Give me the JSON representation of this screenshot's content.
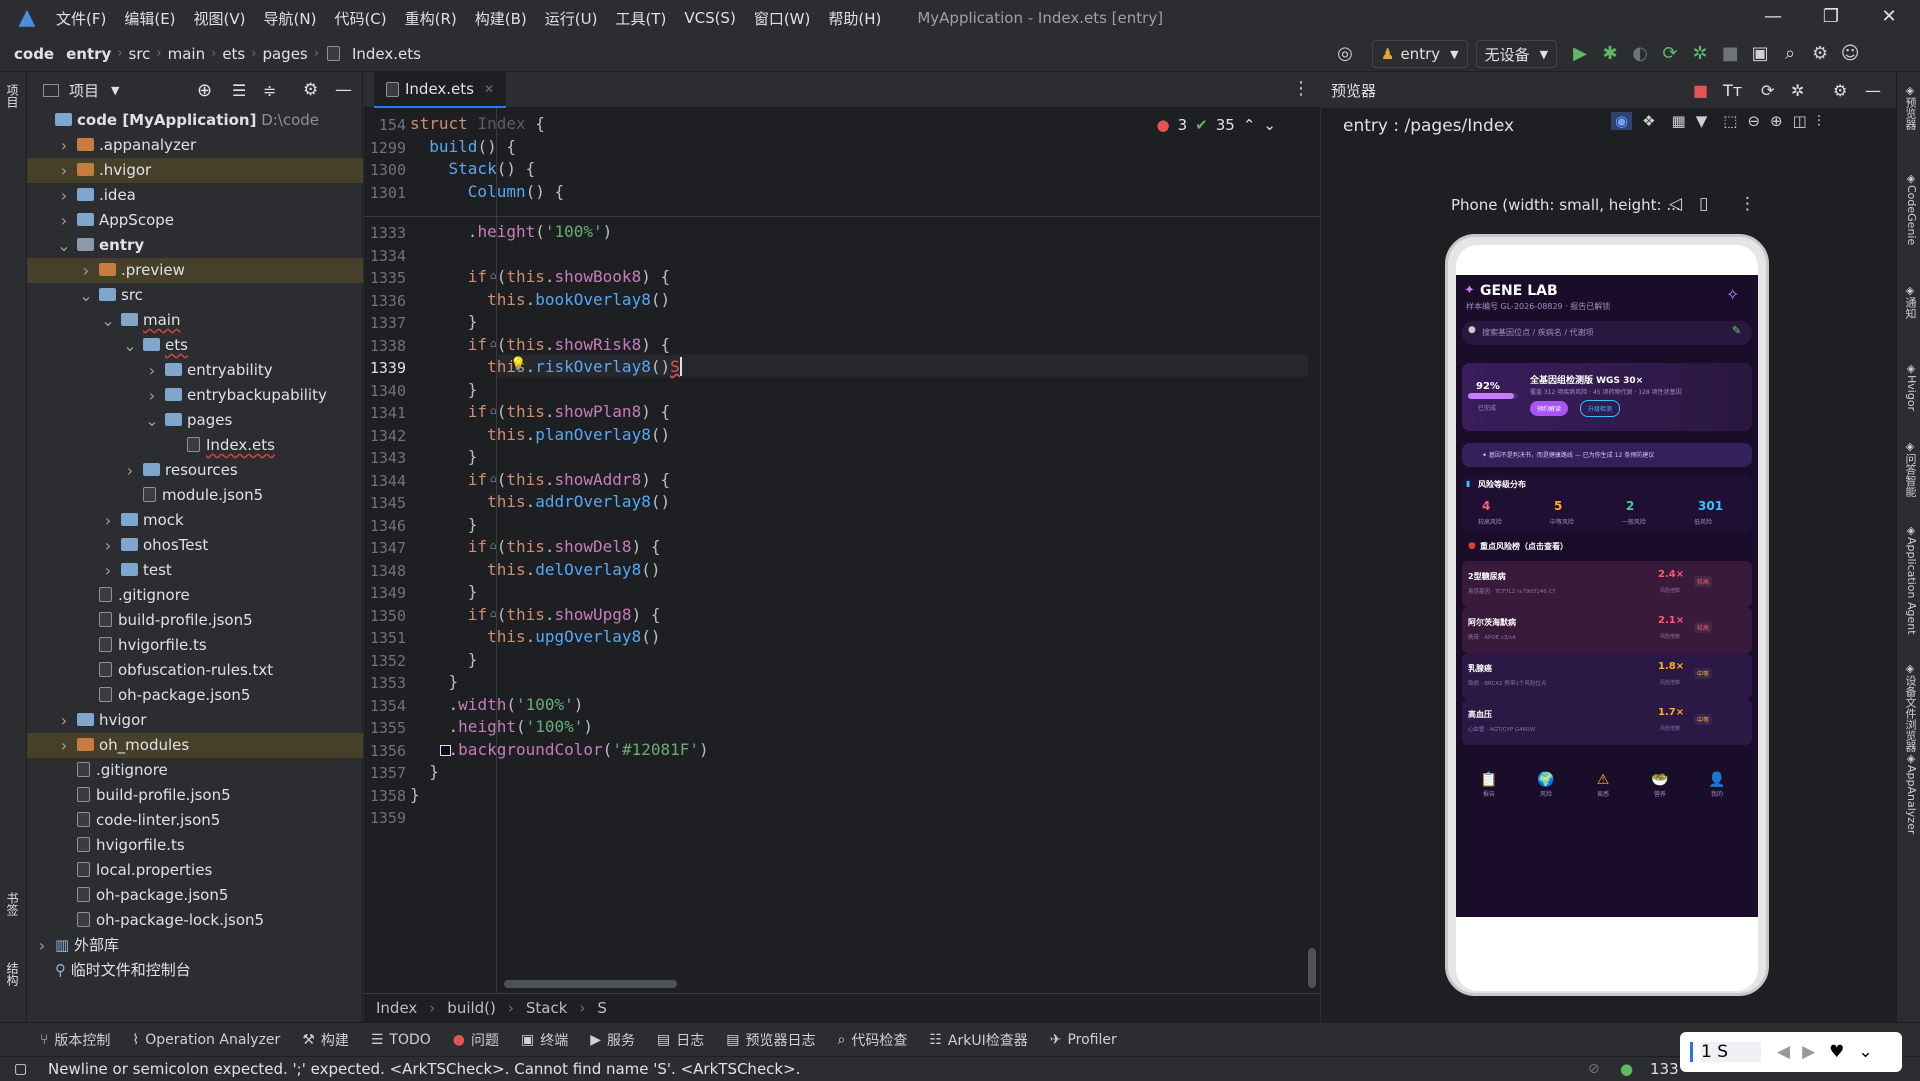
{
  "menubar": {
    "items": [
      "文件(F)",
      "编辑(E)",
      "视图(V)",
      "导航(N)",
      "代码(C)",
      "重构(R)",
      "构建(B)",
      "运行(U)",
      "工具(T)",
      "VCS(S)",
      "窗口(W)",
      "帮助(H)"
    ],
    "title": "MyApplication - Index.ets [entry]"
  },
  "navbar": {
    "crumbs": [
      "code",
      "entry",
      "src",
      "main",
      "ets",
      "pages",
      "Index.ets"
    ],
    "run_config": "entry",
    "device": "无设备"
  },
  "project": {
    "title": "项目",
    "root_name": "code [MyApplication]",
    "root_path": "D:\\code",
    "rows": [
      ".appanalyzer",
      ".hvigor",
      ".idea",
      "AppScope",
      "entry",
      ".preview",
      "src",
      "main",
      "ets",
      "entryability",
      "entrybackupability",
      "pages",
      "Index.ets",
      "resources",
      "module.json5",
      "mock",
      "ohosTest",
      "test",
      ".gitignore",
      "build-profile.json5",
      "hvigorfile.ts",
      "obfuscation-rules.txt",
      "oh-package.json5",
      "hvigor",
      "oh_modules",
      ".gitignore",
      "build-profile.json5",
      "code-linter.json5",
      "hvigorfile.ts",
      "local.properties",
      "oh-package.json5",
      "oh-package-lock.json5",
      "外部库",
      "临时文件和控制台"
    ]
  },
  "editor": {
    "tab": "Index.ets",
    "errors": "3",
    "warnings": "35",
    "sticky": [
      {
        "ln": "154",
        "code": "struct Index {"
      },
      {
        "ln": "1299",
        "code": "  build() {"
      },
      {
        "ln": "1300",
        "code": "    Stack() {"
      },
      {
        "ln": "1301",
        "code": "      Column() {"
      }
    ],
    "lines": [
      {
        "ln": "1333",
        "code": "      .height('100%')"
      },
      {
        "ln": "1334",
        "code": ""
      },
      {
        "ln": "1335",
        "code": "      if (this.showBook8) {"
      },
      {
        "ln": "1336",
        "code": "        this.bookOverlay8()"
      },
      {
        "ln": "1337",
        "code": "      }"
      },
      {
        "ln": "1338",
        "code": "      if (this.showRisk8) {"
      },
      {
        "ln": "1339",
        "code": "        this.riskOverlay8()S"
      },
      {
        "ln": "1340",
        "code": "      }"
      },
      {
        "ln": "1341",
        "code": "      if (this.showPlan8) {"
      },
      {
        "ln": "1342",
        "code": "        this.planOverlay8()"
      },
      {
        "ln": "1343",
        "code": "      }"
      },
      {
        "ln": "1344",
        "code": "      if (this.showAddr8) {"
      },
      {
        "ln": "1345",
        "code": "        this.addrOverlay8()"
      },
      {
        "ln": "1346",
        "code": "      }"
      },
      {
        "ln": "1347",
        "code": "      if (this.showDel8) {"
      },
      {
        "ln": "1348",
        "code": "        this.delOverlay8()"
      },
      {
        "ln": "1349",
        "code": "      }"
      },
      {
        "ln": "1350",
        "code": "      if (this.showUpg8) {"
      },
      {
        "ln": "1351",
        "code": "        this.upgOverlay8()"
      },
      {
        "ln": "1352",
        "code": "      }"
      },
      {
        "ln": "1353",
        "code": "    }"
      },
      {
        "ln": "1354",
        "code": "    .width('100%')"
      },
      {
        "ln": "1355",
        "code": "    .height('100%')"
      },
      {
        "ln": "1356",
        "code": "    .backgroundColor('#12081F')"
      },
      {
        "ln": "1357",
        "code": "  }"
      },
      {
        "ln": "1358",
        "code": "}"
      },
      {
        "ln": "1359",
        "code": ""
      }
    ],
    "breadcrumb": [
      "Index",
      "build()",
      "Stack",
      "S"
    ]
  },
  "preview": {
    "title": "预览器",
    "path": "entry : /pages/Index",
    "device": "Phone (width: small, height: ...",
    "app": {
      "brand": "GENE LAB",
      "sub": "样本编号 GL-2026-08829 · 报告已解锁",
      "search": "搜索基因位点 / 疾病名 / 代谢项",
      "pct": "92%",
      "pct_sub": "已完成",
      "card_title": "全基因组检测版 WGS 30×",
      "card_desc": "覆盖 312 项疾病风险 · 45 项药物代谢 · 128 项性状基因",
      "btn1": "预约解读",
      "btn2": "升级检测",
      "notice": "✦ 基因不是判决书，而是健康路线 — 已为你生成 12 条预防建议",
      "dist_title": "风险等级分布",
      "dist": [
        {
          "v": "4",
          "l": "较高风险",
          "c": "#ff5a6e"
        },
        {
          "v": "5",
          "l": "中等风险",
          "c": "#ffb020"
        },
        {
          "v": "2",
          "l": "一般风险",
          "c": "#3ed598"
        },
        {
          "v": "301",
          "l": "低风险",
          "c": "#33c3ff"
        }
      ],
      "risk_title": "重点风险榜（点击查看）",
      "risks": [
        {
          "name": "2型糖尿病",
          "sub": "易感基因 · TCF7L2 rs7903146 CT",
          "v": "2.4×",
          "vs": "风险倍数",
          "tag": "较高",
          "c": "#ff5a6e"
        },
        {
          "name": "阿尔茨海默病",
          "sub": "携带 · APOE ε3/ε4",
          "v": "2.1×",
          "vs": "风险倍数",
          "tag": "较高",
          "c": "#ff5a6e"
        },
        {
          "name": "乳腺癌",
          "sub": "致病 · BRCA2 携带1个风险位点",
          "v": "1.8×",
          "vs": "风险倍数",
          "tag": "中等",
          "c": "#ffb020"
        },
        {
          "name": "高血压",
          "sub": "心血管 · AGT/CYP G460W",
          "v": "1.7×",
          "vs": "风险倍数",
          "tag": "中等",
          "c": "#ffb020"
        }
      ],
      "nav": [
        "报告",
        "风险",
        "易感",
        "营养",
        "我的"
      ]
    }
  },
  "toolwin": [
    "版本控制",
    "Operation Analyzer",
    "构建",
    "TODO",
    "问题",
    "终端",
    "服务",
    "日志",
    "预览器日志",
    "代码检查",
    "ArkUI检查器",
    "Profiler"
  ],
  "status": {
    "message": "Newline or semicolon expected. ';' expected. <ArkTSCheck>. Cannot find name 'S'. <ArkTSCheck>.",
    "pos": "133",
    "ime": "1 S"
  },
  "right_strip": [
    "预览器",
    "CodeGenie",
    "通知",
    "Hvigor",
    "问答智能",
    "Application Agent",
    "设备文件浏览器",
    "AppAnalyzer"
  ],
  "left_strip": [
    "项目",
    "书签",
    "结构"
  ]
}
